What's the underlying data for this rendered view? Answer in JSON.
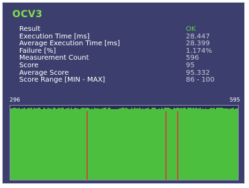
{
  "title": "OCV3",
  "metrics": [
    {
      "label": "Result",
      "value": "OK",
      "ok": true
    },
    {
      "label": "Execution Time [ms]",
      "value": "28.447"
    },
    {
      "label": "Average Execution Time [ms]",
      "value": "28.399"
    },
    {
      "label": "Failure [%]",
      "value": "1.174%"
    },
    {
      "label": "Measurement Count",
      "value": "596"
    },
    {
      "label": "Score",
      "value": "95"
    },
    {
      "label": "Average Score",
      "value": "95.332"
    },
    {
      "label": "Score Range [MIN - MAX]",
      "value": "86 - 100"
    }
  ],
  "chart": {
    "x_min_label": "296",
    "x_max_label": "595",
    "bar_color": "#4dbf3f",
    "fail_color": "#c0503a",
    "fail_marker_fractions": [
      0.335,
      0.682,
      0.732
    ]
  }
}
